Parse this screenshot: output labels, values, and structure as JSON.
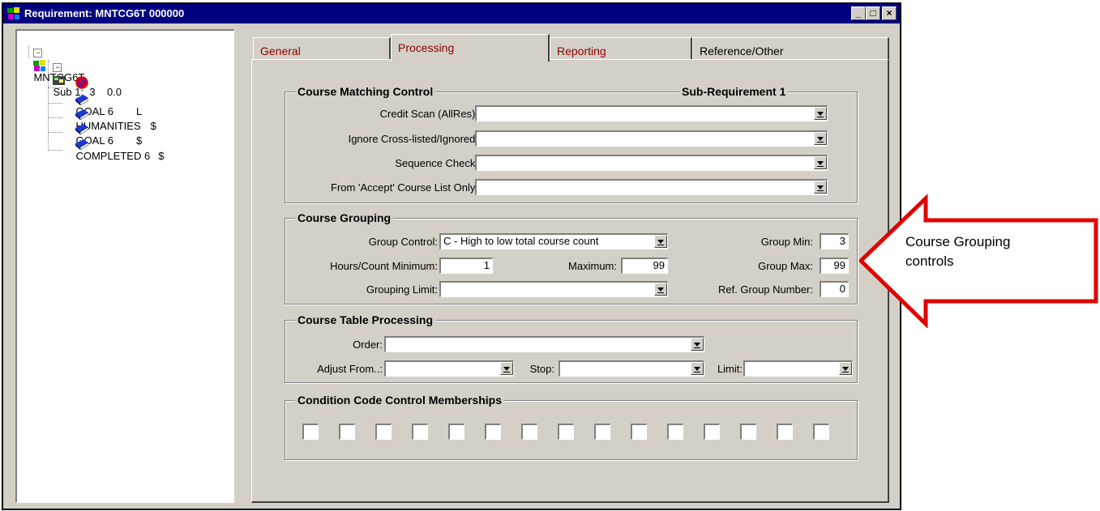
{
  "window": {
    "title": "Requirement: MNTCG6T   000000",
    "controls": [
      "_",
      "□",
      "×"
    ]
  },
  "tree": {
    "root": "MNTCG6T",
    "sub": "Sub 1:  3    0.0",
    "items": [
      {
        "name": "GOAL 6",
        "flag": "L"
      },
      {
        "name": "HUMANITIES",
        "flag": "$"
      },
      {
        "name": "GOAL 6",
        "flag": "$"
      },
      {
        "name": "COMPLETED 6",
        "flag": "$"
      }
    ]
  },
  "tabs": [
    {
      "label": "General",
      "active": false
    },
    {
      "label": "Processing",
      "active": true
    },
    {
      "label": "Reporting",
      "active": false
    },
    {
      "label": "Reference/Other",
      "active": false
    }
  ],
  "course_matching": {
    "title": "Course Matching Control",
    "subtitle": "Sub-Requirement 1",
    "fields": [
      {
        "label": "Credit Scan (AllRes):",
        "value": ""
      },
      {
        "label": "Ignore Cross-listed/Ignored:",
        "value": ""
      },
      {
        "label": "Sequence Check:",
        "value": ""
      },
      {
        "label": "From 'Accept' Course List Only:",
        "value": ""
      }
    ]
  },
  "course_grouping": {
    "title": "Course Grouping",
    "group_control_label": "Group Control:",
    "group_control_value": "C - High to low total course count",
    "hours_min_label": "Hours/Count Minimum:",
    "hours_min_value": "1",
    "maximum_label": "Maximum:",
    "maximum_value": "99",
    "grouping_limit_label": "Grouping Limit:",
    "grouping_limit_value": "",
    "group_min_label": "Group Min:",
    "group_min_value": "3",
    "group_max_label": "Group Max:",
    "group_max_value": "99",
    "ref_group_label": "Ref. Group Number:",
    "ref_group_value": "0"
  },
  "course_table": {
    "title": "Course Table Processing",
    "order_label": "Order:",
    "order_value": "",
    "adjust_label": "Adjust From..:",
    "adjust_value": "",
    "stop_label": "Stop:",
    "stop_value": "",
    "limit_label": "Limit:",
    "limit_value": ""
  },
  "condition_codes": {
    "title": "Condition Code Control Memberships",
    "checkbox_count": 15
  },
  "callout": {
    "line1": "Course Grouping",
    "line2": "controls",
    "color": "#e00000"
  }
}
